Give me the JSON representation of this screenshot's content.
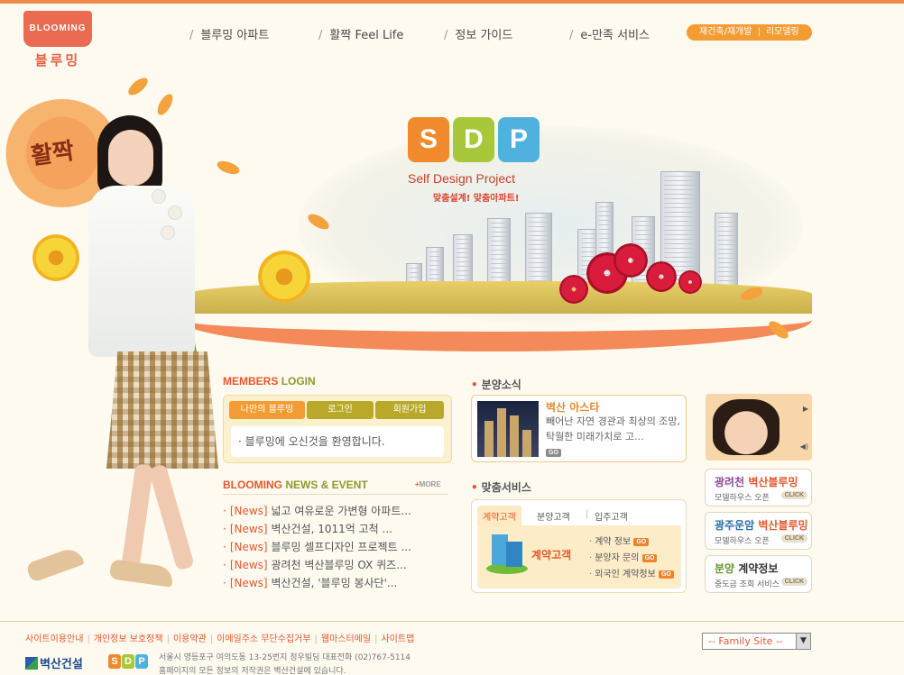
{
  "logo": {
    "brand_en": "BLOOMING",
    "brand_ko": "블루밍"
  },
  "nav": {
    "items": [
      "블루밍 아파트",
      "활짝 Feel Life",
      "정보 가이드",
      "e-만족 서비스"
    ],
    "quick": [
      "재건축/재개발",
      "리모델링"
    ]
  },
  "hero": {
    "sdp_letters": [
      "S",
      "D",
      "P"
    ],
    "title": "Self Design Project",
    "subtitle": "맞춤설계! 맞춤아파트!",
    "flower_text": "활짝",
    "colors": {
      "s": "#f08a2c",
      "d": "#a9c73a",
      "p": "#4fb2de"
    }
  },
  "members": {
    "title_a": "MEMBERS",
    "title_b": "LOGIN",
    "tabs": [
      "나만의 블루밍",
      "로그인",
      "회원가입"
    ],
    "welcome": "블루밍에 오신것을 환영합니다."
  },
  "news": {
    "title_a": "BLOOMING",
    "title_b": "NEWS & EVENT",
    "more": "MORE",
    "items": [
      {
        "tag": "[News]",
        "text": "넓고 여유로운 가변형 아파트..."
      },
      {
        "tag": "[News]",
        "text": "벽산건설, 1011억 고척 ..."
      },
      {
        "tag": "[News]",
        "text": "블루밍 셀프디자인 프로젝트 ..."
      },
      {
        "tag": "[News]",
        "text": "광려천 벽산블루밍 OX 퀴즈..."
      },
      {
        "tag": "[News]",
        "text": "벽산건설, '블루밍 봉사단'..."
      }
    ]
  },
  "sales": {
    "title": "분양소식",
    "item_title": "벽산 아스타",
    "item_desc": "빼어난 자연 경관과 최상의 조망, 탁월한 미래가치로 고...",
    "go": "GO"
  },
  "service": {
    "title": "맞춤서비스",
    "tabs": [
      "계약고객",
      "분양고객",
      "입주고객"
    ],
    "panel_label": "계약고객",
    "links": [
      "계약 정보",
      "분양자 문의",
      "외국인 계약정보"
    ],
    "go": "GO"
  },
  "promos": [
    {
      "a": "광려천",
      "b": "벽산블루밍",
      "sub": "모델하우스 오픈",
      "click": "CLICK"
    },
    {
      "a": "광주운암",
      "b": "벽산블루밍",
      "sub": "모델하우스 오픈",
      "click": "CLICK"
    },
    {
      "a": "분양",
      "b": "계약정보",
      "sub": "중도금 조회 서비스",
      "click": "CLICK"
    }
  ],
  "footer": {
    "links": [
      "사이트이용안내",
      "개인정보 보호정책",
      "이용약관",
      "이메일주소 무단수집거부",
      "웹마스터메일",
      "사이트맵"
    ],
    "family_site": "-- Family Site --",
    "company": "벽산건설",
    "address": "서울시 영등포구 여의도동 13-25번지 정우빌딩 대표전화 (02)767-5114",
    "copyright": "홈페이지의 모든 정보의 저작권은 벽산건설에 있습니다."
  }
}
